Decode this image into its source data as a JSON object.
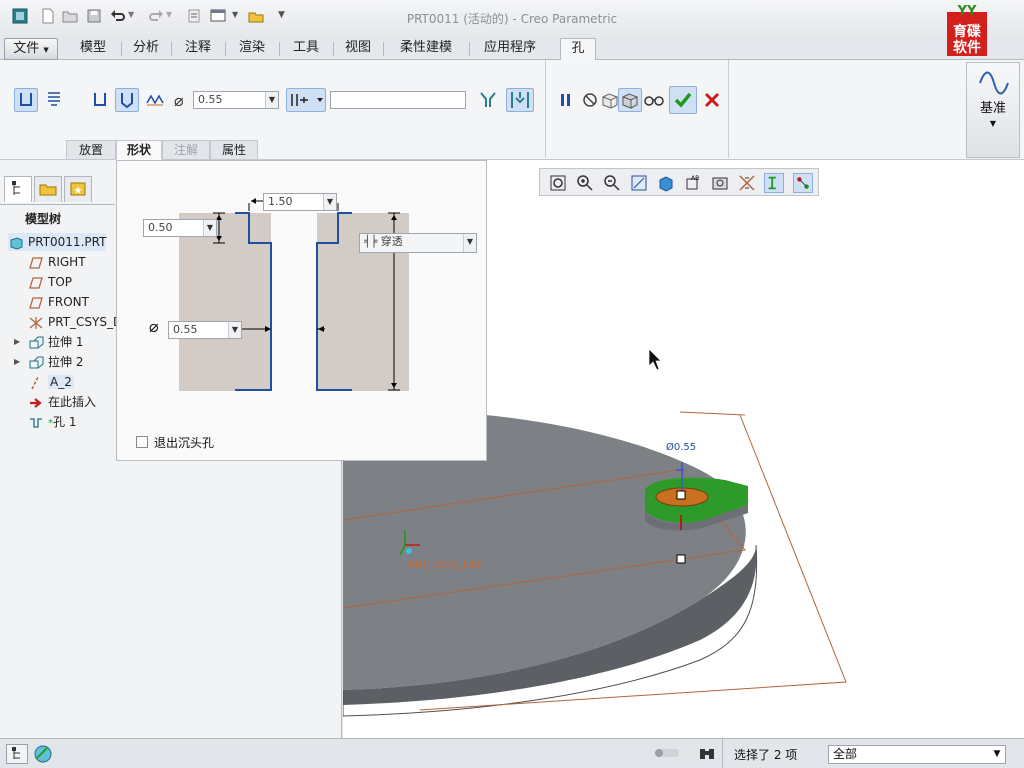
{
  "window": {
    "title": "PRT0011 (活动的) - Creo Parametric"
  },
  "logo": {
    "top_text": "YY",
    "text": "育碟\n软件"
  },
  "tabs": [
    "文件",
    "模型",
    "分析",
    "注释",
    "渲染",
    "工具",
    "视图",
    "柔性建模",
    "应用程序",
    "孔"
  ],
  "ribbon": {
    "diameter_value": "0.55",
    "depth_text": "",
    "datum_label": "基准",
    "groups": [
      "放置",
      "形状",
      "注解",
      "属性"
    ]
  },
  "tree": {
    "title": "模型树",
    "items": [
      {
        "label": "PRT0011.PRT",
        "icon": "part-icon"
      },
      {
        "label": "RIGHT",
        "icon": "datum-plane-icon"
      },
      {
        "label": "TOP",
        "icon": "datum-plane-icon"
      },
      {
        "label": "FRONT",
        "icon": "datum-plane-icon"
      },
      {
        "label": "PRT_CSYS_D",
        "icon": "csys-icon"
      },
      {
        "label": "拉伸 1",
        "icon": "extrude-icon"
      },
      {
        "label": "拉伸 2",
        "icon": "extrude-icon"
      },
      {
        "label": "A_2",
        "icon": "axis-icon"
      },
      {
        "label": "在此插入",
        "icon": "insert-arrow-icon"
      },
      {
        "label": "孔 1",
        "icon": "hole-icon"
      }
    ]
  },
  "shape": {
    "top_value": "1.50",
    "left_value": "0.50",
    "dia_value": "0.55",
    "depth_option": "穿透",
    "exit_countersink": "退出沉头孔"
  },
  "viewport": {
    "dim_label": "Ø0.55",
    "csys_label": "PRT_CSYS_DEF"
  },
  "status": {
    "selection": "选择了 2 项",
    "filter": "全部"
  },
  "colors": {
    "accent": "#1f4fa0",
    "model_gray": "#7d8186",
    "hole_green": "#2e9a2a",
    "hole_orange": "#c8701d",
    "ok_green": "#1d9a1d",
    "cancel_red": "#d11a1a"
  }
}
